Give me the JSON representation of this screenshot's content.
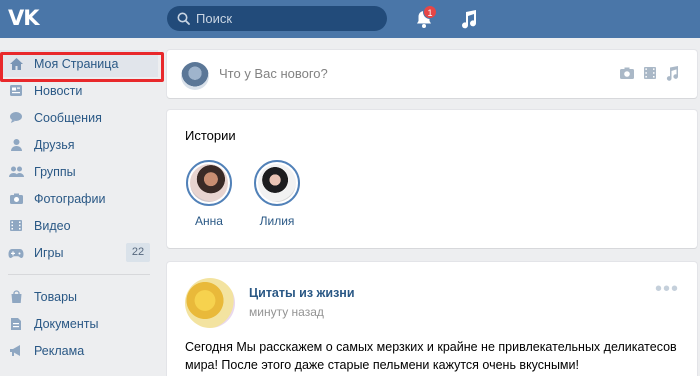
{
  "header": {
    "logo": "VK",
    "search_placeholder": "Поиск",
    "notifications_count": "1",
    "icons": [
      "vk-logo",
      "search-icon",
      "bell-icon",
      "music-icon"
    ]
  },
  "sidebar": {
    "items": [
      {
        "label": "Моя Страница",
        "icon": "home-icon"
      },
      {
        "label": "Новости",
        "icon": "news-icon"
      },
      {
        "label": "Сообщения",
        "icon": "chat-icon"
      },
      {
        "label": "Друзья",
        "icon": "friends-icon"
      },
      {
        "label": "Группы",
        "icon": "groups-icon"
      },
      {
        "label": "Фотографии",
        "icon": "camera-icon"
      },
      {
        "label": "Видео",
        "icon": "video-icon"
      },
      {
        "label": "Игры",
        "icon": "gamepad-icon",
        "count": "22"
      }
    ],
    "items2": [
      {
        "label": "Товары",
        "icon": "bag-icon"
      },
      {
        "label": "Документы",
        "icon": "document-icon"
      },
      {
        "label": "Реклама",
        "icon": "megaphone-icon"
      }
    ]
  },
  "composer": {
    "placeholder": "Что у Вас нового?",
    "icons": [
      "photo-icon",
      "video-icon",
      "music-icon"
    ]
  },
  "stories": {
    "title": "Истории",
    "items": [
      {
        "name": "Анна"
      },
      {
        "name": "Лилия"
      }
    ]
  },
  "post": {
    "author": "Цитаты из жизни",
    "time": "минуту назад",
    "text": "Сегодня Мы расскажем о самых мерзких и крайне не привлекательных деликатесов мира! После этого даже старые пельмени кажутся очень вкусными!"
  },
  "colors": {
    "header": "#4a76a8",
    "link": "#2a5885",
    "highlight": "#e8282b",
    "background": "#edeef0"
  }
}
